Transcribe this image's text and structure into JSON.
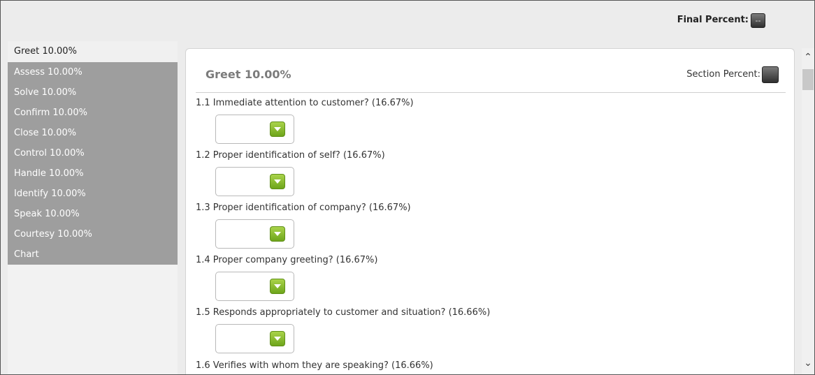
{
  "header": {
    "final_percent_label": "Final Percent:",
    "final_percent_value": "--"
  },
  "sidebar": {
    "items": [
      {
        "label": "Greet 10.00%",
        "active": true
      },
      {
        "label": "Assess 10.00%"
      },
      {
        "label": "Solve 10.00%"
      },
      {
        "label": "Confirm 10.00%"
      },
      {
        "label": "Close 10.00%"
      },
      {
        "label": "Control 10.00%"
      },
      {
        "label": "Handle 10.00%"
      },
      {
        "label": "Identify 10.00%"
      },
      {
        "label": "Speak 10.00%"
      },
      {
        "label": "Courtesy 10.00%"
      },
      {
        "label": "Chart"
      }
    ]
  },
  "section": {
    "title": "Greet 10.00%",
    "percent_label": "Section Percent:",
    "questions": [
      {
        "text": "1.1 Immediate attention to customer? (16.67%)",
        "value": ""
      },
      {
        "text": "1.2 Proper identification of self? (16.67%)",
        "value": ""
      },
      {
        "text": "1.3 Proper identification of company? (16.67%)",
        "value": ""
      },
      {
        "text": "1.4 Proper company greeting? (16.67%)",
        "value": ""
      },
      {
        "text": "1.5 Responds appropriately to customer and situation? (16.66%)",
        "value": ""
      },
      {
        "text": "1.6 Verifies with whom they are speaking? (16.66%)",
        "value": ""
      }
    ]
  },
  "scrollbar": {
    "up_icon": "chevron-up-icon",
    "down_icon": "chevron-down-icon"
  },
  "colors": {
    "sidebar_bg": "#9e9e9e",
    "dropdown_arrow": "#8cc63f",
    "percent_box": "#3a3a3a"
  }
}
